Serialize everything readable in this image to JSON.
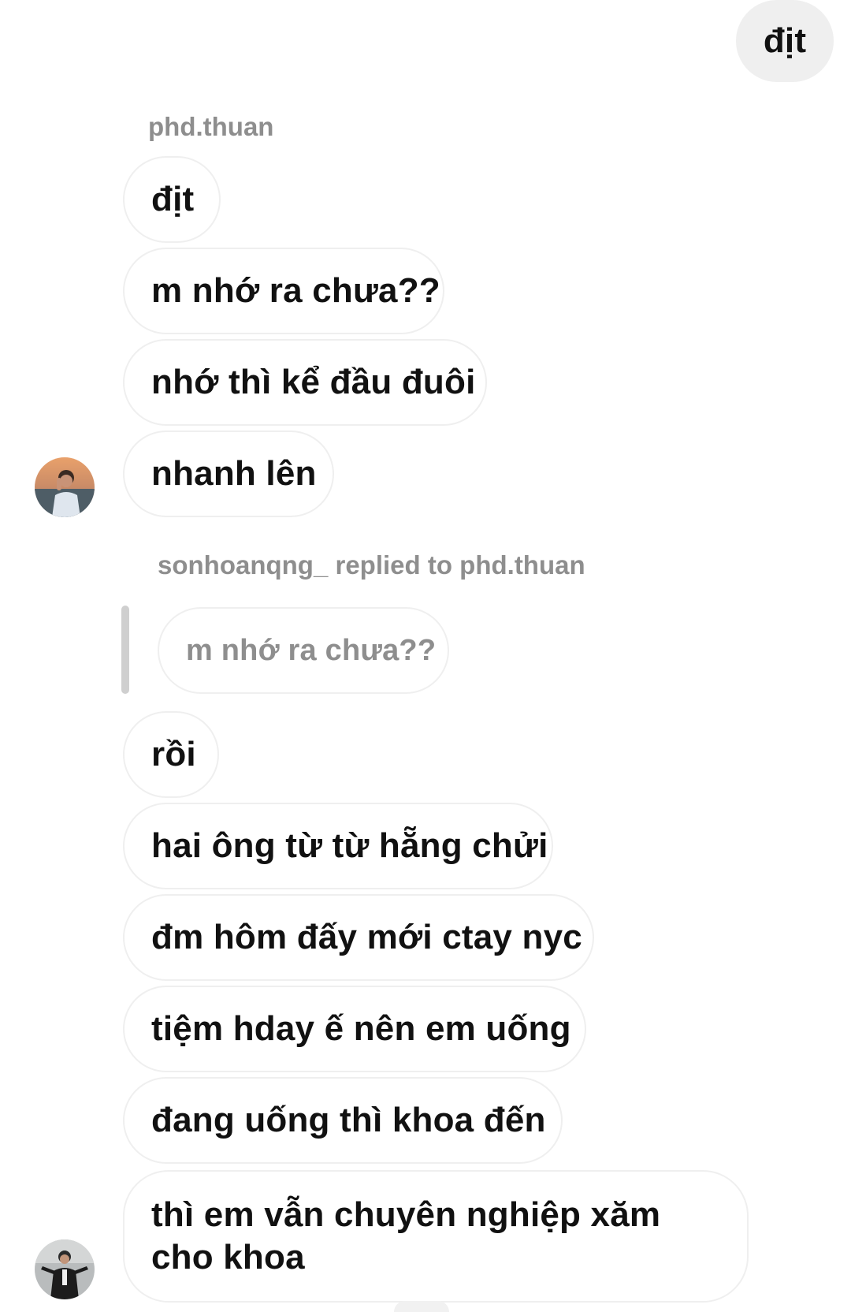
{
  "outgoing": {
    "message": "địt"
  },
  "group1": {
    "sender": "phd.thuan",
    "messages": [
      "địt",
      "m nhớ ra chưa??",
      "nhớ thì kể đầu đuôi",
      "nhanh lên"
    ]
  },
  "group2": {
    "reply_label": "sonhoanqng_ replied to phd.thuan",
    "quoted_message": "m nhớ ra chưa??",
    "messages": [
      "rồi",
      "hai ông từ từ hẵng chửi",
      "đm hôm đấy mới ctay nyc",
      "tiệm hday ế nên em uống",
      "đang uống thì khoa đến",
      "thì em vẫn chuyên nghiệp xăm cho khoa"
    ]
  },
  "colors": {
    "bubble_border": "#efefef",
    "outgoing_bg": "#efefef",
    "meta_text": "#8e8e8e",
    "quote_bar": "#cfcfcf"
  }
}
